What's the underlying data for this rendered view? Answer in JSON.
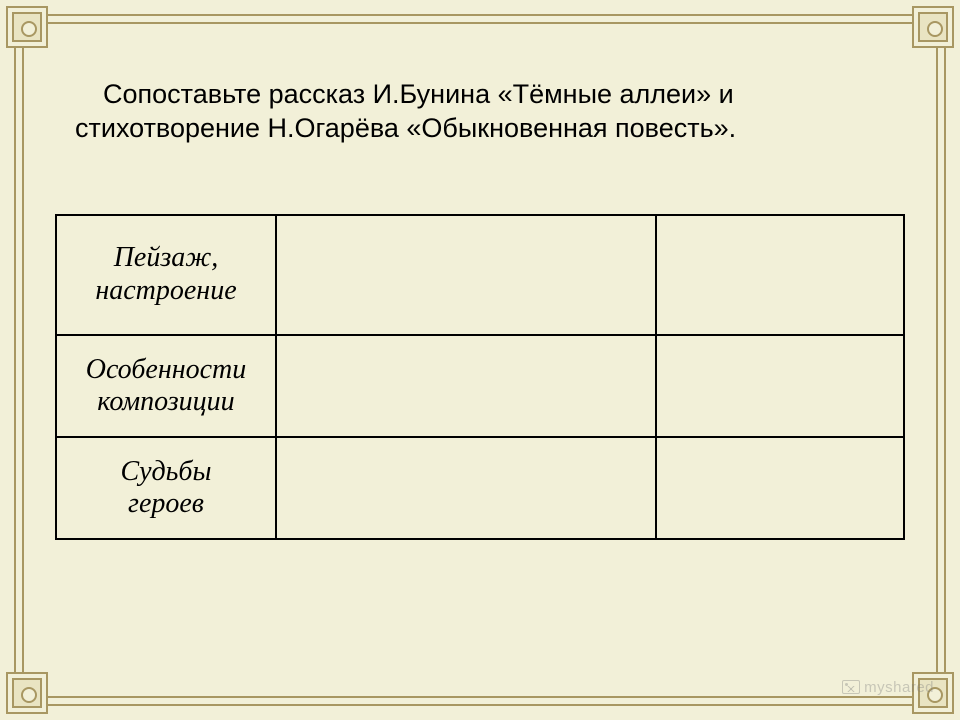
{
  "prompt": {
    "line1": "Сопоставьте рассказ И.Бунина «Тёмные аллеи» и",
    "line2": "стихотворение Н.Огарёва «Обыкновенная повесть»."
  },
  "table": {
    "rows": [
      {
        "header": "Пейзаж, настроение",
        "col2": "",
        "col3": ""
      },
      {
        "header": "Особенности композиции",
        "col2": "",
        "col3": ""
      },
      {
        "header": "Судьбы героев",
        "col2": "",
        "col3": ""
      }
    ]
  },
  "watermark": "myshared"
}
